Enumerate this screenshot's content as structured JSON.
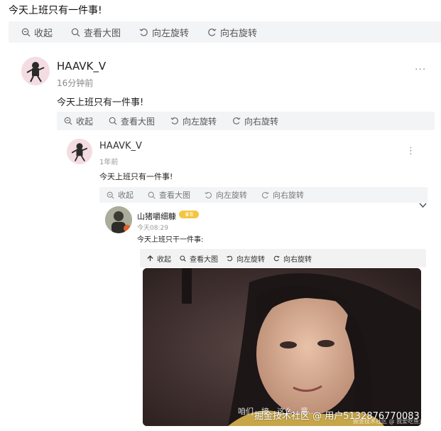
{
  "title": "今天上班只有一件事!",
  "toolbar": {
    "collapse": "收起",
    "view_large": "查看大图",
    "rotate_left": "向左旋转",
    "rotate_right": "向右旋转"
  },
  "comments": [
    {
      "username": "HAAVK_V",
      "time": "16分钟前",
      "text": "今天上班只有一件事!",
      "more": "···"
    },
    {
      "username": "HAAVK_V",
      "time": "1年前",
      "text": "今天上班只有一件事!",
      "more": "⋮"
    },
    {
      "username": "山猪嚼细糠",
      "badge": "8",
      "time": "今天08:29",
      "text": "今天上班只干一件事:"
    }
  ],
  "image": {
    "caption": "咱们…接…这么…意…"
  },
  "watermark": {
    "main": "掘金技术社区 @ 用户5132876770083",
    "secondary": "掘金技术社区 @ 我爱吃鱼丸"
  },
  "colors": {
    "toolbar_bg": "#f3f4f6",
    "badge": "#f5c542",
    "time_text": "#888888"
  }
}
